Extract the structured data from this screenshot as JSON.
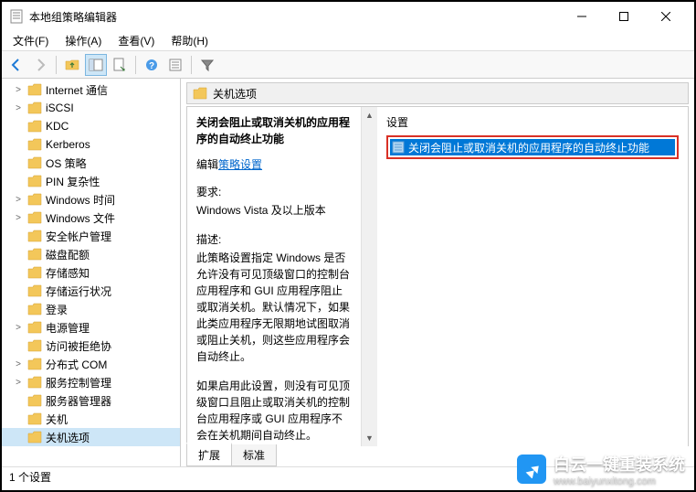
{
  "window": {
    "title": "本地组策略编辑器"
  },
  "menu": {
    "file": "文件(F)",
    "action": "操作(A)",
    "view": "查看(V)",
    "help": "帮助(H)"
  },
  "tree": {
    "items": [
      {
        "label": "Internet 通信",
        "expander": ">"
      },
      {
        "label": "iSCSI",
        "expander": ">"
      },
      {
        "label": "KDC",
        "expander": ""
      },
      {
        "label": "Kerberos",
        "expander": ""
      },
      {
        "label": "OS 策略",
        "expander": ""
      },
      {
        "label": "PIN 复杂性",
        "expander": ""
      },
      {
        "label": "Windows 时间",
        "expander": ">"
      },
      {
        "label": "Windows 文件",
        "expander": ">"
      },
      {
        "label": "安全帐户管理",
        "expander": ""
      },
      {
        "label": "磁盘配额",
        "expander": ""
      },
      {
        "label": "存储感知",
        "expander": ""
      },
      {
        "label": "存储运行状况",
        "expander": ""
      },
      {
        "label": "登录",
        "expander": ""
      },
      {
        "label": "电源管理",
        "expander": ">"
      },
      {
        "label": "访问被拒绝协",
        "expander": ""
      },
      {
        "label": "分布式 COM",
        "expander": ">"
      },
      {
        "label": "服务控制管理",
        "expander": ">"
      },
      {
        "label": "服务器管理器",
        "expander": ""
      },
      {
        "label": "关机",
        "expander": ""
      },
      {
        "label": "关机选项",
        "expander": "",
        "selected": true
      }
    ]
  },
  "details": {
    "header_title": "关机选项",
    "policy_title": "关闭会阻止或取消关机的应用程序的自动终止功能",
    "edit_prefix": "编辑",
    "edit_link": "策略设置",
    "req_label": "要求:",
    "req_value": "Windows Vista 及以上版本",
    "desc_label": "描述:",
    "desc_para1": "此策略设置指定 Windows 是否允许没有可见顶级窗口的控制台应用程序和 GUI 应用程序阻止或取消关机。默认情况下，如果此类应用程序无限期地试图取消或阻止关机，则这些应用程序会自动终止。",
    "desc_para2": "如果启用此设置，则没有可见顶级窗口且阻止或取消关机的控制台应用程序或 GUI 应用程序不会在关机期间自动终止。"
  },
  "settings": {
    "header": "设置",
    "items": [
      {
        "label": "关闭会阻止或取消关机的应用程序的自动终止功能"
      }
    ]
  },
  "tabs": {
    "extended": "扩展",
    "standard": "标准"
  },
  "statusbar": {
    "count": "1 个设置"
  },
  "watermark": {
    "line1": "白云一键重装系统",
    "line2": "www.baiyunxitong.com"
  }
}
